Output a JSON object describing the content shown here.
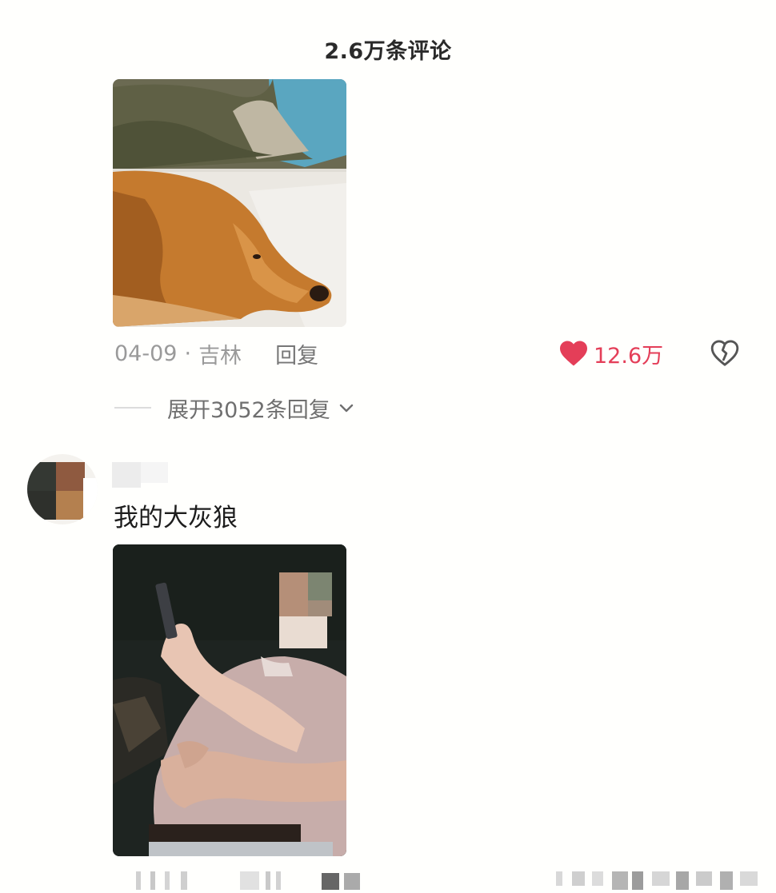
{
  "header": {
    "title": "2.6万条评论"
  },
  "comment1": {
    "date": "04-09",
    "separator": "·",
    "location": "吉林",
    "reply_label": "回复",
    "likes": "12.6万",
    "expand_label": "展开3052条回复",
    "image_desc": "landscape-over-dog-photo"
  },
  "comment2": {
    "text": "我的大灰狼",
    "image_desc": "person-photo"
  },
  "icons": {
    "like": "heart-icon",
    "dislike": "broken-heart-icon",
    "expand": "chevron-down-icon"
  },
  "colors": {
    "like_red": "#e43e58",
    "meta_gray": "#9a9a9a"
  }
}
